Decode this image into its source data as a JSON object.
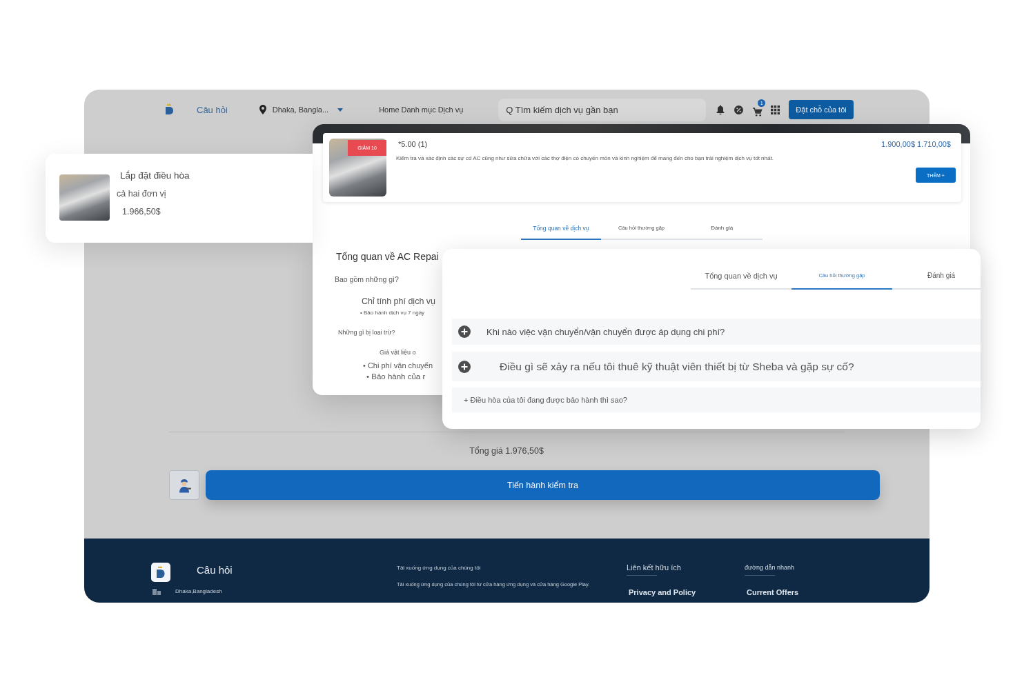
{
  "header": {
    "brand": "Câu hỏi",
    "location": "Dhaka, Bangla...",
    "nav_links": [
      "Home",
      "Danh mục",
      "Dịch vụ"
    ],
    "search": {
      "placeholder": "Q Tìm kiếm dịch vụ gần bạn"
    },
    "cart_count": "1",
    "booking_button": "Đặt chỗ của tôi"
  },
  "cart_item": {
    "title": "Lắp đặt điều hòa",
    "subtitle": "cả hai đơn vị",
    "price": "1.966,50$"
  },
  "service": {
    "discount": "GIẢM 10",
    "rating": "*5.00 (1)",
    "price": "1.900,00$ 1.710,00$",
    "description": "Kiểm tra và xác định các sự cố AC cũng như sửa chữa với các thợ điện có chuyên môn và kinh nghiệm để mang đến cho bạn trải nghiệm dịch vụ tốt nhất.",
    "add_button": "THÊM +",
    "tabs": [
      {
        "label": "Tổng quan về dịch vụ",
        "selected": true
      },
      {
        "label": "Câu hỏi thường gặp",
        "selected": false
      },
      {
        "label": "Đánh giá",
        "selected": false
      }
    ],
    "overview": {
      "title": "Tổng quan về AC Repai",
      "included_heading": "Bao gồm những gì?",
      "included": [
        "Chỉ tính phí dịch vụ",
        "• Bảo hành dịch vụ 7 ngày"
      ],
      "excluded_heading": "Những gì bị loại trừ?",
      "excluded": [
        "Giá vật liệu o",
        "• Chi phí vận chuyển",
        "• Bảo hành của r"
      ]
    }
  },
  "faq": {
    "tabs": [
      {
        "label": "Tổng quan về dịch vụ",
        "selected": false
      },
      {
        "label": "Câu hỏi thường gặp",
        "selected": true
      },
      {
        "label": "Đánh giá",
        "selected": false
      }
    ],
    "questions": [
      {
        "kind": "icon",
        "text": "Khi nào việc vận chuyển/vận chuyển được áp dụng chi phí?"
      },
      {
        "kind": "icon",
        "text": "Điều gì sẽ xảy ra nếu tôi thuê kỹ thuật viên thiết bị từ Sheba và gặp sự cố?"
      },
      {
        "kind": "plain",
        "text": "+ Điều hòa của tôi đang được bảo hành thì sao?"
      }
    ]
  },
  "checkout": {
    "total": "Tổng giá 1.976,50$",
    "button": "Tiến hành kiểm tra"
  },
  "footer": {
    "brand": "Câu hỏi",
    "address": "Dhaka,Bangladesh",
    "app_heading": "Tải xuống ứng dụng của chúng tôi",
    "app_text": "Tải xuống ứng dụng của chúng tôi từ cửa hàng ứng dụng và cửa hàng Google Play.",
    "columns": [
      {
        "heading": "Liên kết hữu ích",
        "link": "Privacy and Policy"
      },
      {
        "heading": "đường dẫn nhanh",
        "link": "Current Offers"
      }
    ]
  }
}
